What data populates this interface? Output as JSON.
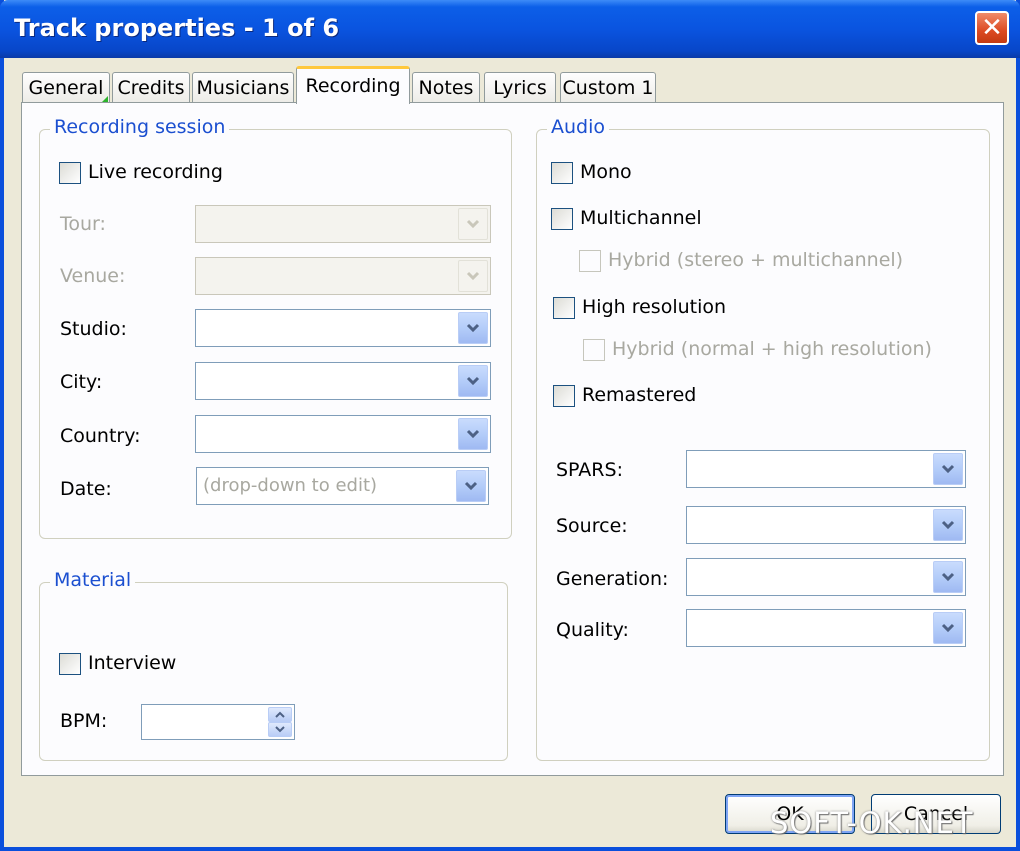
{
  "window": {
    "title": "Track properties - 1 of 6"
  },
  "tabs": [
    {
      "label": "General"
    },
    {
      "label": "Credits"
    },
    {
      "label": "Musicians"
    },
    {
      "label": "Recording"
    },
    {
      "label": "Notes"
    },
    {
      "label": "Lyrics"
    },
    {
      "label": "Custom 1"
    }
  ],
  "active_tab": "Recording",
  "recording_session": {
    "legend": "Recording session",
    "live_recording": {
      "label": "Live recording",
      "checked": false
    },
    "fields": [
      {
        "label": "Tour:",
        "value": "",
        "enabled": false
      },
      {
        "label": "Venue:",
        "value": "",
        "enabled": false
      },
      {
        "label": "Studio:",
        "value": "",
        "enabled": true
      },
      {
        "label": "City:",
        "value": "",
        "enabled": true
      },
      {
        "label": "Country:",
        "value": "",
        "enabled": true
      },
      {
        "label": "Date:",
        "value": "(drop-down to edit)",
        "enabled": true
      }
    ]
  },
  "material": {
    "legend": "Material",
    "interview": {
      "label": "Interview",
      "checked": false
    },
    "bpm": {
      "label": "BPM:",
      "value": ""
    }
  },
  "audio": {
    "legend": "Audio",
    "mono": {
      "label": "Mono",
      "checked": false
    },
    "multichannel": {
      "label": "Multichannel",
      "checked": false
    },
    "hybrid_multichannel": {
      "label": "Hybrid (stereo + multichannel)",
      "checked": false,
      "enabled": false
    },
    "high_resolution": {
      "label": "High resolution",
      "checked": false
    },
    "hybrid_hires": {
      "label": "Hybrid (normal + high resolution)",
      "checked": false,
      "enabled": false
    },
    "remastered": {
      "label": "Remastered",
      "checked": false
    },
    "fields": [
      {
        "label": "SPARS:",
        "value": ""
      },
      {
        "label": "Source:",
        "value": ""
      },
      {
        "label": "Generation:",
        "value": ""
      },
      {
        "label": "Quality:",
        "value": ""
      }
    ]
  },
  "buttons": {
    "ok": "OK",
    "cancel": "Cancel"
  },
  "watermark": "SOFT-OK.NET",
  "colors": {
    "title_bar": "#0a54e0",
    "group_legend": "#1b4fd0",
    "active_tab_accent": "#ffc83c",
    "close_button": "#dc4a22"
  }
}
